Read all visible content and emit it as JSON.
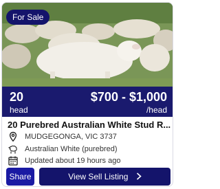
{
  "listing": {
    "badge": "For Sale",
    "head_count": "20",
    "head_unit": "head",
    "price": "$700 - $1,000",
    "price_unit": "/head",
    "title": "20 Purebred Australian White Stud R...",
    "location": "MUDGEGONGA, VIC 3737",
    "breed": "Australian White (purebred)",
    "updated": "Updated about 19 hours ago"
  },
  "actions": {
    "share_label": "Share",
    "view_label": "View Sell Listing",
    "view_icon": "chevron-right-icon"
  },
  "icons": {
    "location": "map-pin-icon",
    "breed": "sheep-icon",
    "updated": "calendar-icon"
  },
  "colors": {
    "navy": "#14146b",
    "share_blue": "#1a1aa3"
  }
}
